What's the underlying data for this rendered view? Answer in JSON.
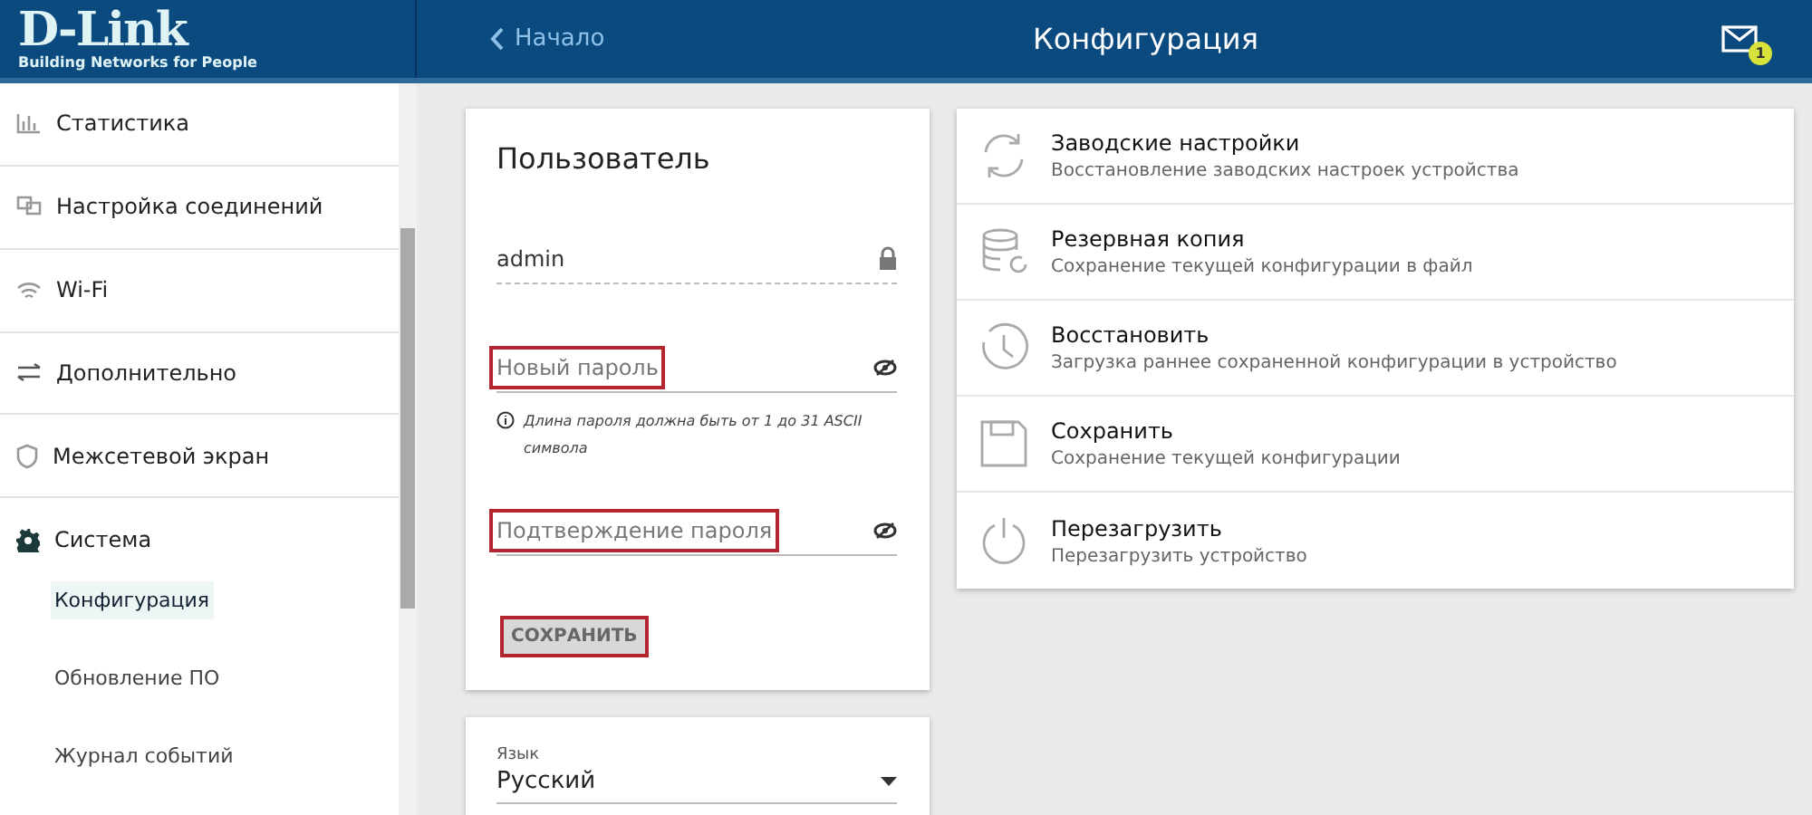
{
  "header": {
    "logo": "D-Link",
    "tagline": "Building Networks for People",
    "back_link": "Начало",
    "title": "Конфигурация",
    "notifications": "1"
  },
  "sidebar": {
    "items": [
      {
        "label": "Статистика",
        "expanded": false
      },
      {
        "label": "Настройка соединений",
        "expanded": false
      },
      {
        "label": "Wi-Fi",
        "expanded": false
      },
      {
        "label": "Дополнительно",
        "expanded": false
      },
      {
        "label": "Межсетевой экран",
        "expanded": false
      },
      {
        "label": "Система",
        "expanded": true,
        "children": [
          {
            "label": "Конфигурация",
            "selected": true
          },
          {
            "label": "Обновление ПО",
            "selected": false
          },
          {
            "label": "Журнал событий",
            "selected": false
          }
        ]
      }
    ]
  },
  "user_card": {
    "title": "Пользователь",
    "fields": [
      {
        "kind": "locked",
        "value": "admin",
        "highlighted": false
      },
      {
        "kind": "password",
        "placeholder": "Новый пароль",
        "highlighted": true
      },
      {
        "kind": "hint",
        "text": "Длина пароля должна быть от 1 до 31 ASCII символа"
      },
      {
        "kind": "password",
        "placeholder": "Подтверждение пароля",
        "highlighted": true
      }
    ],
    "save_button": {
      "label": "СОХРАНИТЬ",
      "highlighted": true
    }
  },
  "language_card": {
    "label": "Язык",
    "value": "Русский"
  },
  "actions": [
    {
      "title": "Заводские настройки",
      "description": "Восстановление заводских настроек устройства"
    },
    {
      "title": "Резервная копия",
      "description": "Сохранение текущей конфигурации в файл"
    },
    {
      "title": "Восстановить",
      "description": "Загрузка раннее сохраненной конфигурации в устройство"
    },
    {
      "title": "Сохранить",
      "description": "Сохранение текущей конфигурации"
    },
    {
      "title": "Перезагрузить",
      "description": "Перезагрузить устройство"
    }
  ]
}
